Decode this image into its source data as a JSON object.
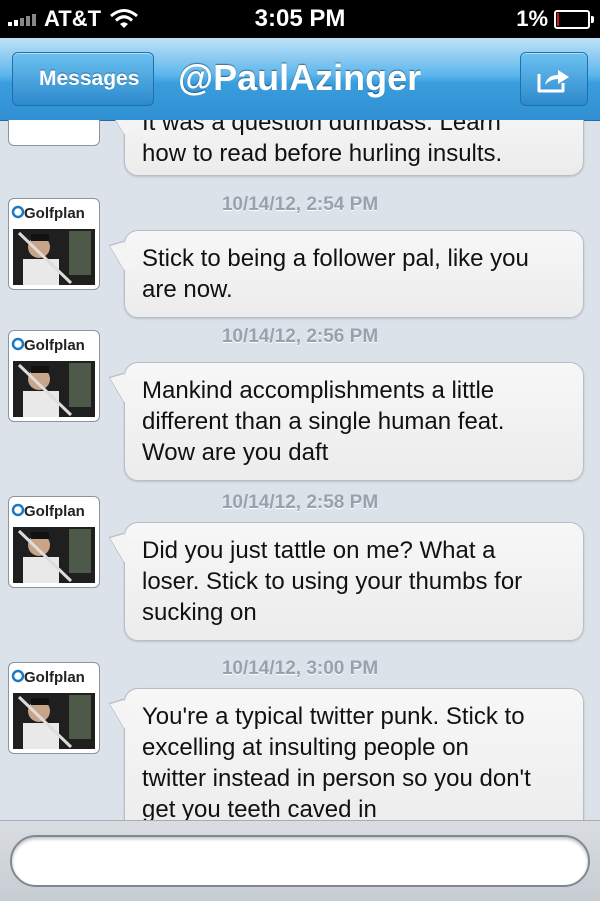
{
  "status_bar": {
    "carrier": "AT&T",
    "time": "3:05 PM",
    "battery_percent": "1%",
    "battery_level": 0.01,
    "signal_bars": 2,
    "icons": [
      "signal-icon",
      "wifi-icon",
      "battery-icon"
    ]
  },
  "nav": {
    "back_label": "Messages",
    "title": "@PaulAzinger",
    "share_icon": "share-icon"
  },
  "avatar_text": "Golfplan",
  "messages": [
    {
      "timestamp": "",
      "lines": [
        "It was a question dumbass. Learn",
        "how to read before hurling insults."
      ]
    },
    {
      "timestamp": "10/14/12, 2:54 PM",
      "lines": [
        "Stick to being a follower pal, like you",
        "are now."
      ]
    },
    {
      "timestamp": "10/14/12, 2:56 PM",
      "lines": [
        "Mankind accomplishments a little",
        "different than a single human feat.",
        "Wow are you daft"
      ]
    },
    {
      "timestamp": "10/14/12, 2:58 PM",
      "lines": [
        "Did you just tattle on me? What a",
        "loser. Stick to using your thumbs for",
        "sucking on"
      ]
    },
    {
      "timestamp": "10/14/12, 3:00 PM",
      "lines": [
        "You're a typical twitter punk. Stick to",
        "excelling at insulting people on",
        "twitter instead in person so you don't",
        "get you teeth caved in"
      ]
    }
  ],
  "input": {
    "value": "",
    "placeholder": ""
  },
  "colors": {
    "nav_blue": "#3a9ddd",
    "background": "#dbe2ea",
    "timestamp": "#98a2ad",
    "battery_low": "#e11111"
  }
}
